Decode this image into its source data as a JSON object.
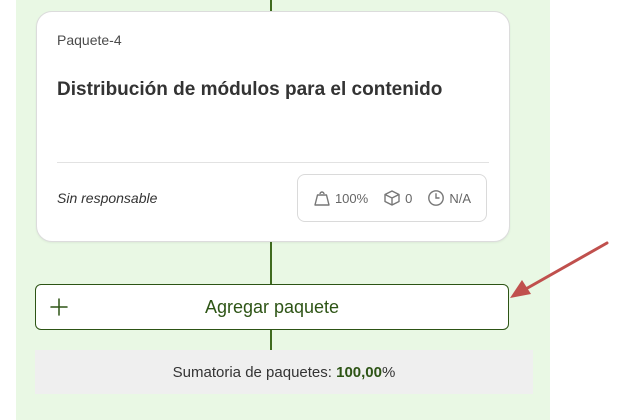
{
  "package_card": {
    "code": "Paquete-4",
    "title": "Distribución de módulos para el contenido",
    "owner": "Sin responsable",
    "metrics": {
      "weight": "100%",
      "deliverables": "0",
      "duration": "N/A"
    }
  },
  "add_package_button": {
    "label": "Agregar paquete"
  },
  "summary": {
    "label": "Sumatoria de paquetes:",
    "value": "100,00",
    "unit": "%"
  },
  "colors": {
    "accent": "#2d5415",
    "column_bg": "#e9f8e4",
    "arrow": "#c0504d"
  },
  "icons": [
    "weight-icon",
    "box-icon",
    "clock-icon",
    "plus-icon",
    "arrow-annotation"
  ]
}
